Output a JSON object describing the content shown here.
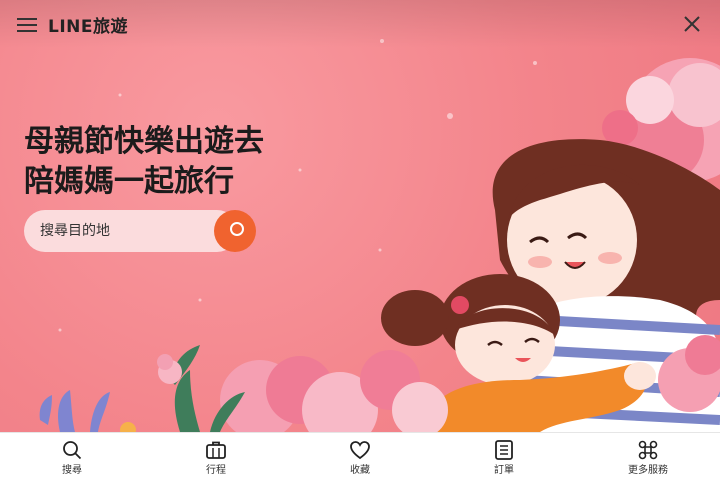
{
  "header": {
    "brand": "LINE旅遊",
    "menu_icon": "hamburger-menu-icon",
    "close_icon": "close-icon"
  },
  "hero": {
    "headline_line1": "母親節快樂出遊去",
    "headline_line2": "陪媽媽一起旅行",
    "search_placeholder": "搜尋目的地",
    "search_icon": "search-icon"
  },
  "bottom_nav": {
    "items": [
      {
        "label": "搜尋",
        "icon": "search-icon"
      },
      {
        "label": "行程",
        "icon": "briefcase-icon"
      },
      {
        "label": "收藏",
        "icon": "heart-icon"
      },
      {
        "label": "訂單",
        "icon": "list-icon"
      },
      {
        "label": "更多服務",
        "icon": "command-icon"
      }
    ]
  },
  "colors": {
    "hero_background": "#f3848b",
    "accent": "#f0632f",
    "search_field": "#fbdcdd",
    "text_dark": "#1b1b1b"
  }
}
